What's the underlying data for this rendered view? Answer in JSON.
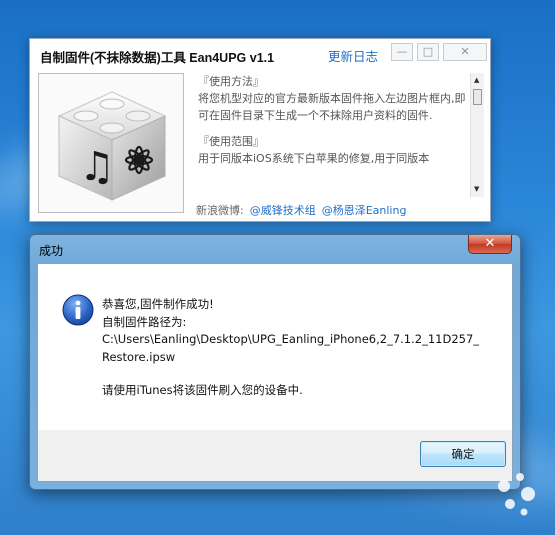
{
  "app": {
    "title": "自制固件(不抹除数据)工具 Ean4UPG v1.1",
    "changelog_link": "更新日志",
    "controls": {
      "minimize": "—",
      "maximize": "□",
      "close": "✕"
    },
    "info": {
      "usage_heading": "『使用方法』",
      "usage_text": "将您机型对应的官方最新版本固件拖入左边图片框内,即可在固件目录下生成一个不抹除用户资料的固件.",
      "scope_heading": "『使用范围』",
      "scope_text": "用于同版本iOS系统下白苹果的修复,用于同版本"
    },
    "weibo_label": "新浪微博:",
    "weibo_links": [
      "@威锋技术组",
      "@杨恩泽Eanling"
    ]
  },
  "dialog": {
    "title": "成功",
    "close": "✕",
    "lines": [
      "恭喜您,固件制作成功!",
      "自制固件路径为:",
      "C:\\Users\\Eanling\\Desktop\\UPG_Eanling_iPhone6,2_7.1.2_11D257_",
      "Restore.ipsw"
    ],
    "instruction": "请使用iTunes将该固件刷入您的设备中.",
    "ok_button": "确定",
    "icon": "info-icon"
  },
  "colors": {
    "desktop": "#2a86d8",
    "link": "#1f6fc8",
    "dialog_frame": "#7ab0dd",
    "close_red": "#c03a22"
  }
}
